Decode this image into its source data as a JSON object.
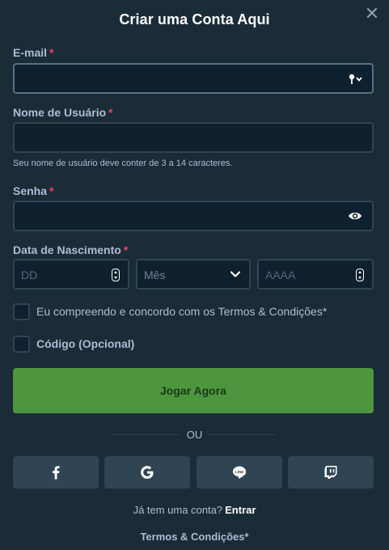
{
  "modal": {
    "title": "Criar uma Conta Aqui",
    "close_glyph": "✕"
  },
  "form": {
    "email": {
      "label": "E-mail",
      "required_mark": "*",
      "value": "",
      "trailing_icon": "key-icon"
    },
    "username": {
      "label": "Nome de Usuário",
      "required_mark": "*",
      "value": "",
      "hint": "Seu nome de usuário deve conter de 3 a 14 caracteres."
    },
    "password": {
      "label": "Senha",
      "required_mark": "*",
      "value": "",
      "trailing_icon": "eye-icon"
    },
    "birthdate": {
      "label": "Data de Nascimento",
      "required_mark": "*",
      "day_placeholder": "DD",
      "month_selected": "Mês",
      "year_placeholder": "AAAA"
    },
    "terms_checkbox": {
      "label": "Eu compreendo e concordo com os Termos & Condições*",
      "checked": false
    },
    "code_checkbox": {
      "label": "Código (Opcional)",
      "checked": false
    },
    "submit_label": "Jogar Agora"
  },
  "divider_text": "OU",
  "social_buttons": [
    {
      "name": "facebook",
      "icon": "facebook-icon"
    },
    {
      "name": "google",
      "icon": "google-icon"
    },
    {
      "name": "line",
      "icon": "line-icon"
    },
    {
      "name": "twitch",
      "icon": "twitch-icon"
    }
  ],
  "footer": {
    "signin_prompt": "Já tem uma conta?",
    "signin_link": "Entrar",
    "terms_link": "Termos & Condições*"
  },
  "colors": {
    "background": "#1a2c38",
    "input_background": "#0f212e",
    "border": "#2f4553",
    "primary_button": "#4d953e",
    "required": "#ed4163"
  }
}
